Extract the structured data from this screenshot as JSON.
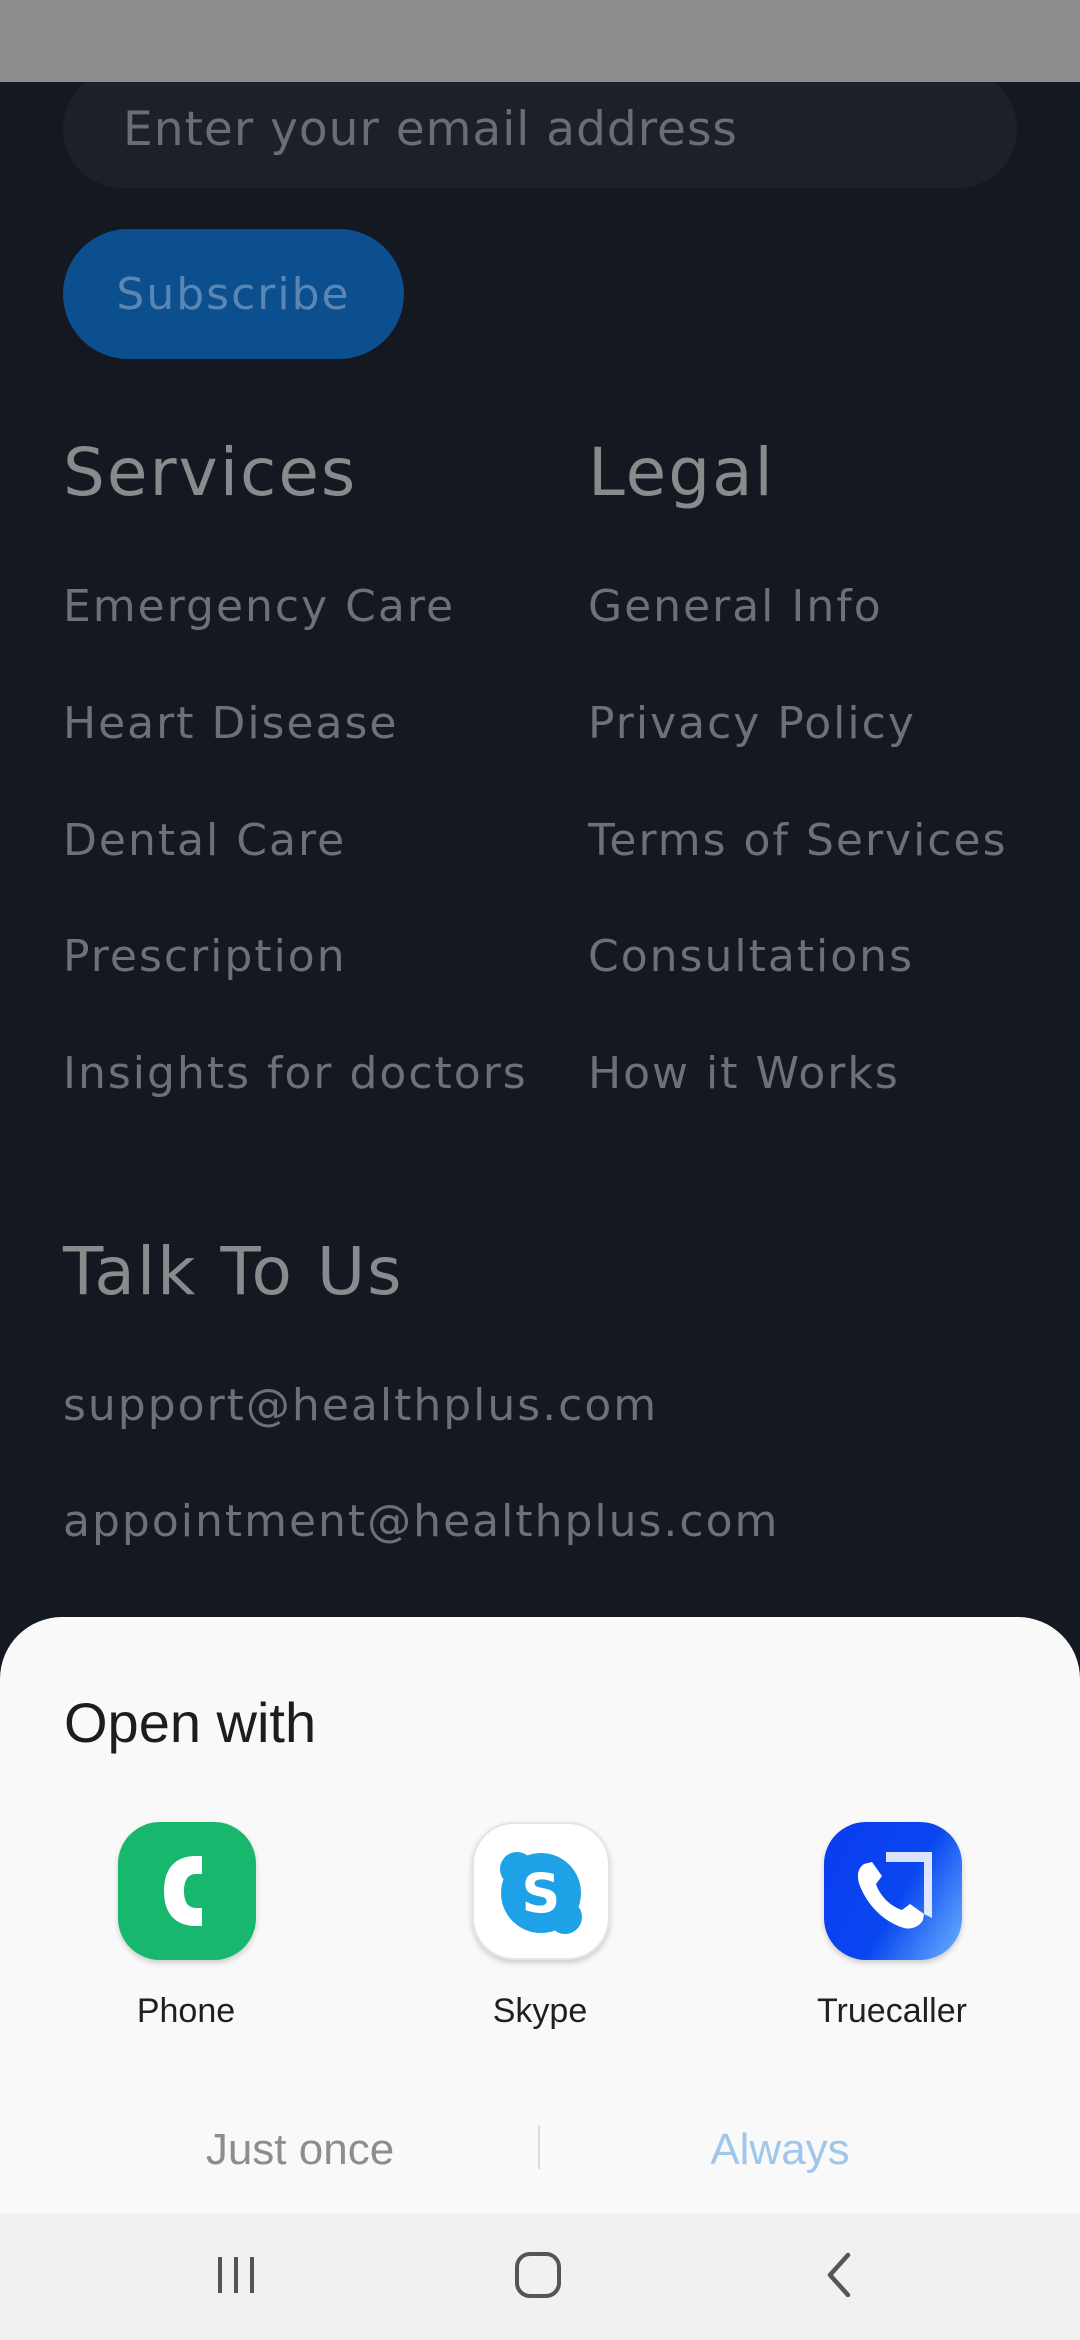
{
  "footer": {
    "email_placeholder": "Enter your email address",
    "subscribe_label": "Subscribe",
    "services": {
      "heading": "Services",
      "links": [
        "Emergency Care",
        "Heart Disease",
        "Dental Care",
        "Prescription",
        "Insights for doctors"
      ]
    },
    "legal": {
      "heading": "Legal",
      "links": [
        "General Info",
        "Privacy Policy",
        "Terms of Services",
        "Consultations",
        "How it Works"
      ]
    },
    "contact": {
      "heading": "Talk To Us",
      "emails": [
        "support@healthplus.com",
        "appointment@healthplus.com"
      ]
    }
  },
  "open_with": {
    "title": "Open with",
    "apps": [
      {
        "name": "Phone",
        "icon": "phone-app-icon",
        "color": "#17b86e"
      },
      {
        "name": "Skype",
        "icon": "skype-app-icon",
        "color": "#1ea1e6"
      },
      {
        "name": "Truecaller",
        "icon": "truecaller-app-icon",
        "color": "#0a46f0"
      }
    ],
    "just_once_label": "Just once",
    "always_label": "Always",
    "just_once_color": "#8d8d8d",
    "always_color": "#9fc6ec"
  },
  "nav": {
    "recents_icon": "recents-icon",
    "home_icon": "home-icon",
    "back_icon": "back-icon"
  }
}
